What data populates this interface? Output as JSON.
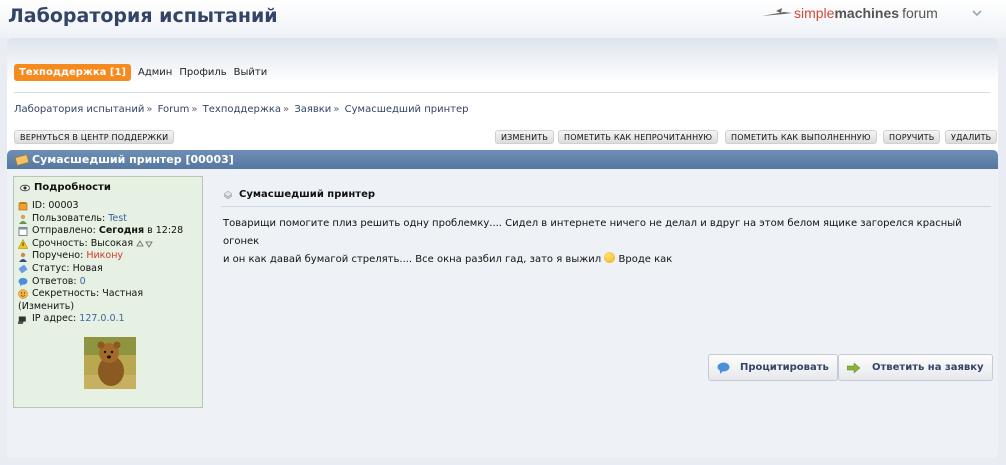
{
  "header": {
    "forum_title": "Лаборатория испытаний",
    "logo": {
      "w1": "simple",
      "w2": "machines",
      "w3": "forum"
    },
    "collapse_icon": "chevron-down-icon"
  },
  "menu": {
    "active_label": "Техподдержка [1]",
    "items": [
      "Админ",
      "Профиль",
      "Выйти"
    ]
  },
  "breadcrumb": [
    "Лаборатория испытаний",
    "Forum",
    "Техподдержка",
    "Заявки",
    "Сумасшедший принтер"
  ],
  "buttons": {
    "back": "ВЕРНУТЬСЯ В ЦЕНТР ПОДДЕРЖКИ",
    "edit": "ИЗМЕНИТЬ",
    "mark_unread": "ПОМЕТИТЬ КАК НЕПРОЧИТАННУЮ",
    "mark_done": "ПОМЕТИТЬ КАК ВЫПОЛНЕННУЮ",
    "assign": "ПОРУЧИТЬ",
    "delete": "УДАЛИТЬ"
  },
  "ticket": {
    "header_title": "Сумасшедший принтер [00003]",
    "details_title": "Подробности",
    "id_label": "ID:",
    "id_value": "00003",
    "user_label": "Пользователь:",
    "user_value": "Test",
    "sent_label": "Отправлено:",
    "sent_value": "Сегодня",
    "sent_time": "в 12:28",
    "urgency_label": "Срочность:",
    "urgency_value": "Высокая",
    "assigned_label": "Поручено:",
    "assigned_value": "Никону",
    "status_label": "Статус:",
    "status_value": "Новая",
    "replies_label": "Ответов:",
    "replies_value": "0",
    "privacy_label": "Секретность:",
    "privacy_value": "Частная",
    "privacy_change": "(Изменить)",
    "ip_label": "IP адрес:",
    "ip_value": "127.0.0.1"
  },
  "post": {
    "title": "Сумасшедший принтер",
    "body_1": "Товарищи помогите плиз решить одну проблемку.... Сидел в интернете ничего не делал и вдруг на этом белом ящике загорелся красный огонек",
    "body_2": "и он как давай бумагой стрелять.... Все окна разбил гад, зато я выжил",
    "body_3": "Вроде как",
    "quote_button": "Процитировать",
    "reply_button": "Ответить на заявку"
  },
  "colors": {
    "accent": "#f58a1f",
    "catbar": "#5f80a8",
    "link": "#3a64a0",
    "assigned": "#d03a2a",
    "details_bg": "#e6f1e3"
  }
}
